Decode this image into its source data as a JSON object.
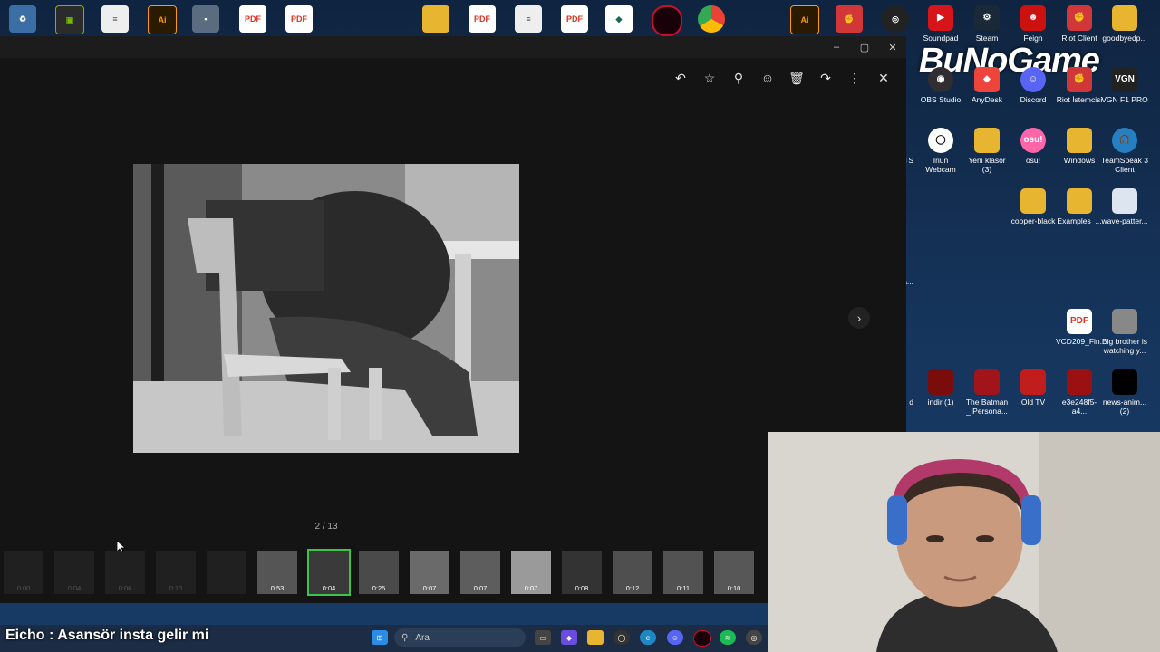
{
  "desktop": {
    "brand": "BuNoGame",
    "icons": [
      {
        "label": "Soundpad"
      },
      {
        "label": "Steam"
      },
      {
        "label": "Feign"
      },
      {
        "label": "Riot Client"
      },
      {
        "label": "goodbyedp..."
      },
      {
        "label": "OBS Studio"
      },
      {
        "label": "AnyDesk"
      },
      {
        "label": "Discord"
      },
      {
        "label": "Riot İstemcisi"
      },
      {
        "label": "VGN F1 PRO"
      },
      {
        "label": "Iriun Webcam"
      },
      {
        "label": "Yeni klasör (3)"
      },
      {
        "label": "osu!"
      },
      {
        "label": "Windows"
      },
      {
        "label": "TeamSpeak 3 Client"
      },
      {
        "label": "cooper-black"
      },
      {
        "label": "Examples_..."
      },
      {
        "label": "wave-patter..."
      },
      {
        "label": "VCD209_Fin..."
      },
      {
        "label": "Big brother is watching y..."
      },
      {
        "label": "indir (1)"
      },
      {
        "label": "The Batman _ Persona..."
      },
      {
        "label": "Old TV"
      },
      {
        "label": "e3e248f5-a4..."
      },
      {
        "label": "news-anim... (2)"
      }
    ],
    "partial_labels": {
      "ts": "TS",
      "d": "d",
      "a": "a..."
    },
    "top_pdf_label": "PDF",
    "ai_label": "Ai"
  },
  "viewer": {
    "counter": "2 / 13",
    "toolbar": {
      "reply": "↶",
      "star": "☆",
      "pin": "⚲",
      "emoji": "☺",
      "delete": "🗑",
      "forward": "↷",
      "more": "⋮",
      "close": "✕"
    },
    "window_controls": {
      "minimize": "–",
      "maximize": "▢",
      "close": "✕"
    },
    "next": "›",
    "thumbnails": [
      {
        "dur": "0:00"
      },
      {
        "dur": "0:04"
      },
      {
        "dur": "0:06"
      },
      {
        "dur": "0:10"
      },
      {
        "dur": ""
      },
      {
        "dur": "0:53"
      },
      {
        "dur": "0:04"
      },
      {
        "dur": "0:25"
      },
      {
        "dur": "0:07"
      },
      {
        "dur": "0:07"
      },
      {
        "dur": "0:07"
      },
      {
        "dur": "0:08"
      },
      {
        "dur": "0:12"
      },
      {
        "dur": "0:11"
      },
      {
        "dur": "0:10"
      }
    ]
  },
  "taskbar": {
    "caption": "Eicho : Asansör insta gelir mi",
    "search_placeholder": "Ara"
  }
}
